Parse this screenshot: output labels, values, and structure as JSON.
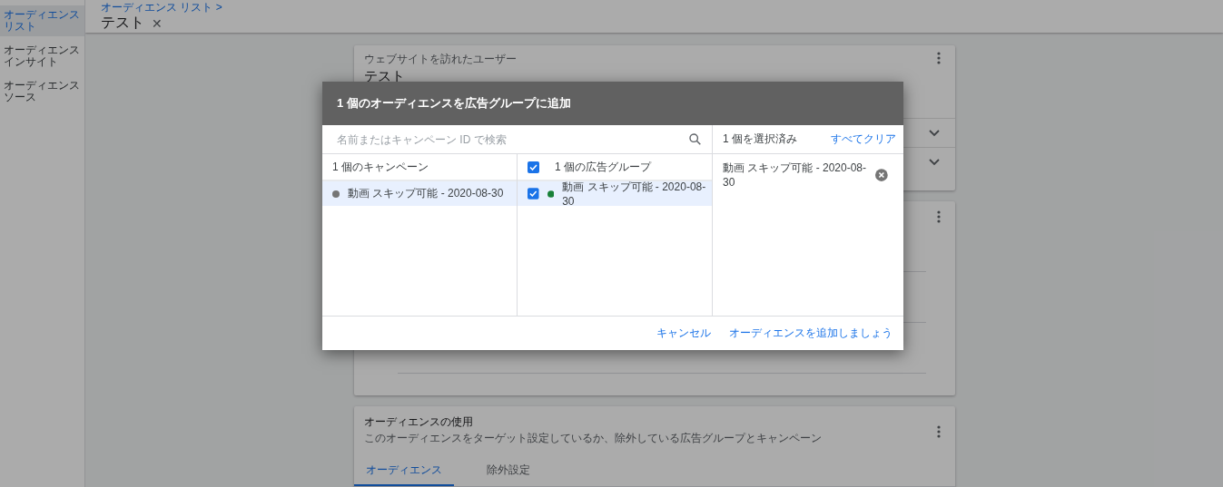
{
  "sidebar": {
    "items": [
      {
        "label": "オーディエンスリスト",
        "selected": true
      },
      {
        "label": "オーディエンスインサイト",
        "selected": false
      },
      {
        "label": "オーディエンスソース",
        "selected": false
      }
    ]
  },
  "header": {
    "breadcrumb": "オーディエンス リスト >",
    "title": "テスト",
    "close": "✕"
  },
  "cards": [
    {
      "kind": "summary",
      "subtitle": "ウェブサイトを訪れたユーザー",
      "title": "テスト",
      "sections": [
        {
          "expanded": false
        },
        {
          "expanded": false
        }
      ]
    },
    {
      "kind": "details"
    },
    {
      "kind": "usage",
      "title": "オーディエンスの使用",
      "description": "このオーディエンスをターゲット設定しているか、除外している広告グループとキャンペーン",
      "tabs": [
        {
          "label": "オーディエンス",
          "selected": true
        },
        {
          "label": "除外設定",
          "selected": false
        }
      ]
    }
  ],
  "dialog": {
    "title": "1 個のオーディエンスを広告グループに追加",
    "search": {
      "placeholder": "名前またはキャンペーン ID で検索"
    },
    "campaigns": {
      "header": "1 個のキャンペーン",
      "rows": [
        {
          "label": "動画 スキップ可能 - 2020-08-30",
          "selected": true,
          "color": "#757575"
        }
      ]
    },
    "ad_groups": {
      "header": "1 個の広告グループ",
      "checked": true,
      "rows": [
        {
          "label": "動画 スキップ可能 - 2020-08-30",
          "selected": true,
          "checked": true,
          "color": "#188038"
        }
      ]
    },
    "selection": {
      "count": "1 個を選択済み",
      "clear": "すべてクリア",
      "items": [
        {
          "label": "動画 スキップ可能 - 2020-08-30"
        }
      ]
    },
    "buttons": [
      {
        "label": "キャンセル"
      },
      {
        "label": "オーディエンスを追加しましょう"
      }
    ]
  }
}
